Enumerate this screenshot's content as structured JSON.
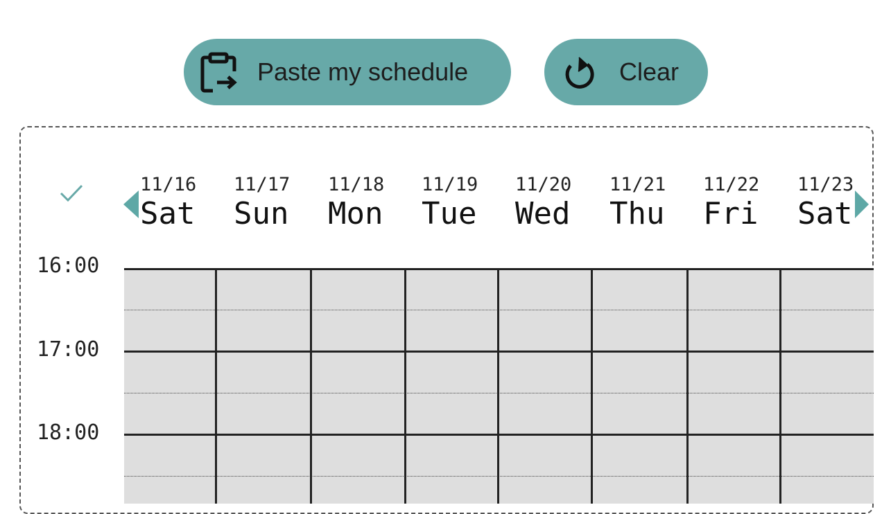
{
  "toolbar": {
    "paste_label": "Paste my schedule",
    "clear_label": "Clear"
  },
  "colors": {
    "accent": "#67a9a8",
    "arrow": "#5ea8a6",
    "cell": "#dedede",
    "grid_line": "#222222"
  },
  "icons": {
    "paste": "clipboard-arrow-icon",
    "clear": "refresh-icon",
    "check": "check-icon",
    "prev": "arrow-left-icon",
    "next": "arrow-right-icon"
  },
  "days": [
    {
      "date": "11/16",
      "dow": "Sat"
    },
    {
      "date": "11/17",
      "dow": "Sun"
    },
    {
      "date": "11/18",
      "dow": "Mon"
    },
    {
      "date": "11/19",
      "dow": "Tue"
    },
    {
      "date": "11/20",
      "dow": "Wed"
    },
    {
      "date": "11/21",
      "dow": "Thu"
    },
    {
      "date": "11/22",
      "dow": "Fri"
    },
    {
      "date": "11/23",
      "dow": "Sat"
    }
  ],
  "times": [
    "16:00",
    "17:00",
    "18:00"
  ]
}
